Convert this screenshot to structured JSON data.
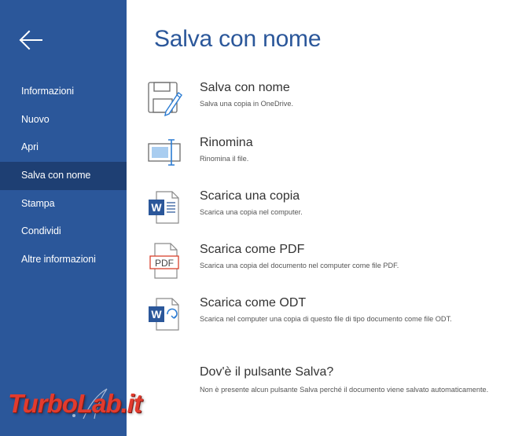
{
  "sidebar": {
    "back_icon": "back-arrow-icon",
    "items": [
      {
        "label": "Informazioni",
        "active": false
      },
      {
        "label": "Nuovo",
        "active": false
      },
      {
        "label": "Apri",
        "active": false
      },
      {
        "label": "Salva con nome",
        "active": true
      },
      {
        "label": "Stampa",
        "active": false
      },
      {
        "label": "Condividi",
        "active": false
      },
      {
        "label": "Altre informazioni",
        "active": false
      }
    ],
    "watermark": "TurboLab.it"
  },
  "main": {
    "title": "Salva con nome",
    "options": [
      {
        "title": "Salva con nome",
        "desc": "Salva una copia in OneDrive.",
        "icon": "save-as-icon"
      },
      {
        "title": "Rinomina",
        "desc": "Rinomina il file.",
        "icon": "rename-icon"
      },
      {
        "title": "Scarica una copia",
        "desc": "Scarica una copia nel computer.",
        "icon": "word-document-icon"
      },
      {
        "title": "Scarica come PDF",
        "desc": "Scarica una copia del documento nel computer come file PDF.",
        "icon": "pdf-document-icon",
        "icon_text": "PDF"
      },
      {
        "title": "Scarica come ODT",
        "desc": "Scarica nel computer una copia di questo file di tipo documento come file ODT.",
        "icon": "odt-document-icon"
      }
    ],
    "info": {
      "title": "Dov'è il pulsante Salva?",
      "desc": "Non è presente alcun pulsante Salva perché il documento viene salvato automaticamente."
    }
  },
  "colors": {
    "sidebar_bg": "#2b579a",
    "sidebar_active_bg": "#1e3f73",
    "accent": "#2b579a",
    "pdf_red": "#d9412c",
    "watermark_red": "#e23b2e"
  }
}
